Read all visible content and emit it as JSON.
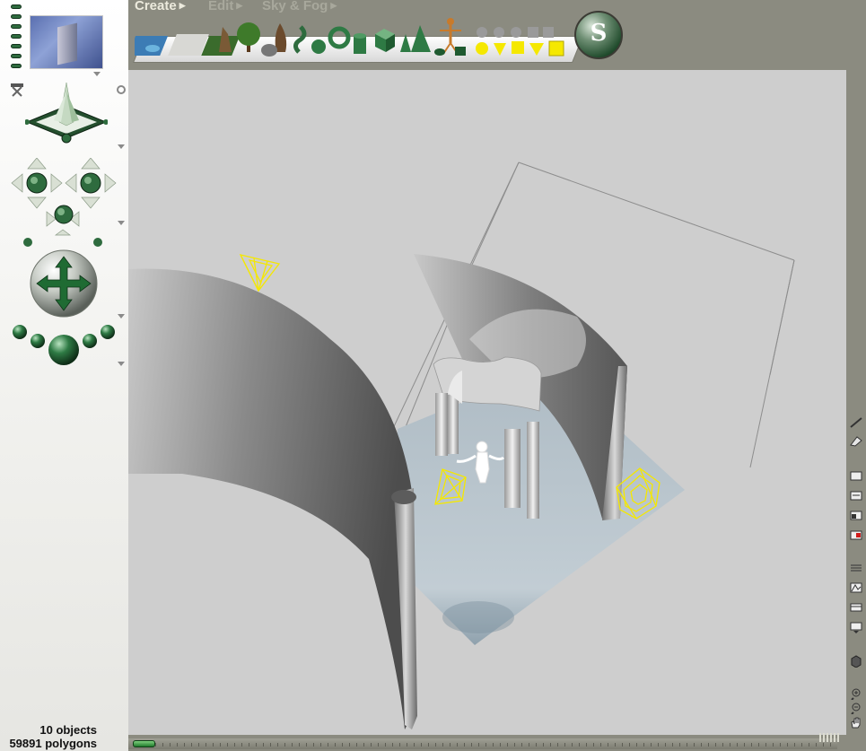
{
  "menu": {
    "create": "Create",
    "edit": "Edit",
    "sky_fog": "Sky & Fog"
  },
  "logo": {
    "letter": "S"
  },
  "status": {
    "objects": "10 objects",
    "polygons": "59891 polygons"
  },
  "colors": {
    "accent_green": "#2e6b3e",
    "camera_yellow": "#f5e800",
    "viewport_bg": "#cecece",
    "ground_plane": "#a9b7c2",
    "chrome": "#8b8b80"
  },
  "object_tray": [
    "water-icon",
    "terrain-icon",
    "rock-icon",
    "plant-icon",
    "tree-icon",
    "stone-icon",
    "snake-icon",
    "sphere-icon",
    "torus-icon",
    "cylinder-icon",
    "cube-icon",
    "cone-icon",
    "pyramid-icon",
    "human-figure-icon",
    "disc-icon",
    "flat-square-icon",
    "primitive-sphere-icon",
    "primitive-cone-icon",
    "primitive-cylinder-icon",
    "primitive-cube-icon"
  ]
}
